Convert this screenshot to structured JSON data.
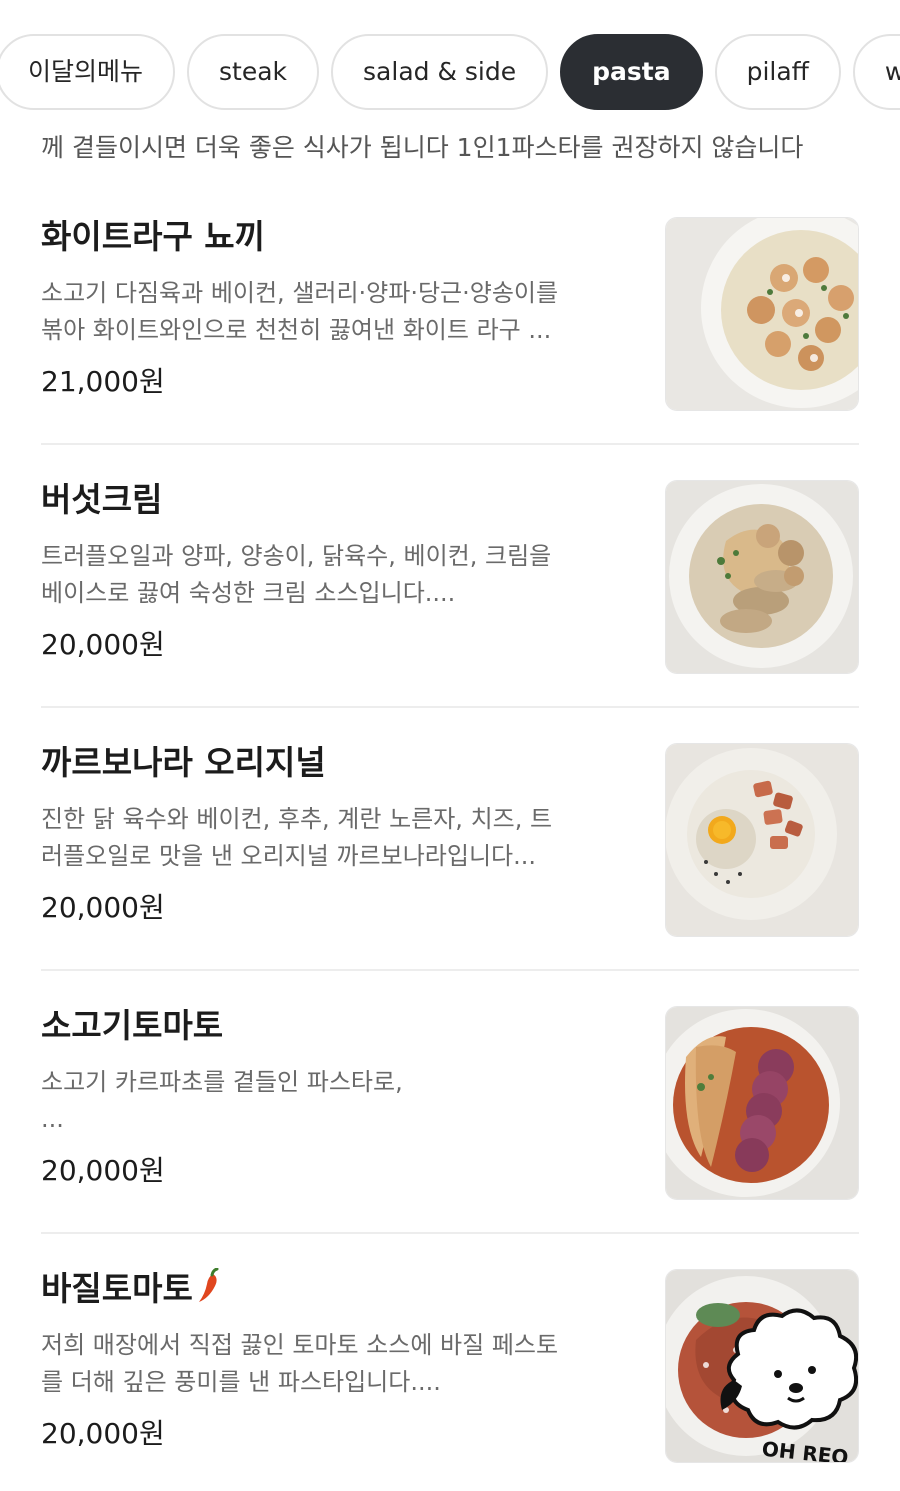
{
  "tabs": [
    {
      "label": "이달의메뉴",
      "active": false
    },
    {
      "label": "steak",
      "active": false
    },
    {
      "label": "salad & side",
      "active": false
    },
    {
      "label": "pasta",
      "active": true
    },
    {
      "label": "pilaff",
      "active": false
    },
    {
      "label": "wine",
      "active": false
    }
  ],
  "notice": "께 곁들이시면 더욱 좋은 식사가 됩니다 1인1파스타를 권장하지 않습니다",
  "menu": [
    {
      "name": "화이트라구 뇨끼",
      "desc": "소고기 다짐육과 베이컨, 샐러리·양파·당근·양송이를\n볶아 화이트와인으로 천천히 끓여낸 화이트 라구 ...",
      "price": "21,000원",
      "photo_icon": "gnocchi-plate"
    },
    {
      "name": "버섯크림",
      "desc": "트러플오일과 양파, 양송이, 닭육수, 베이컨, 크림을\n베이스로 끓여 숙성한 크림 소스입니다....",
      "price": "20,000원",
      "photo_icon": "mushroom-cream-plate"
    },
    {
      "name": "까르보나라 오리지널",
      "desc": "진한 닭 육수와 베이컨, 후추, 계란 노른자, 치즈, 트\n러플오일로 맛을 낸 오리지널 까르보나라입니다...",
      "price": "20,000원",
      "photo_icon": "carbonara-plate"
    },
    {
      "name": "소고기토마토",
      "desc": "소고기 카르파초를 곁들인 파스타로,\n ...",
      "price": "20,000원",
      "photo_icon": "beef-tomato-plate"
    },
    {
      "name": "바질토마토",
      "desc": "저희 매장에서 직접 끓인 토마토 소스에 바질 페스토\n를 더해 깊은 풍미를 낸 파스타입니다....",
      "price": "20,000원",
      "photo_icon": "basil-tomato-plate",
      "spicy_icon": "chili-pepper-icon",
      "watermark": "OH REO"
    }
  ],
  "colors": {
    "active_tab": "#2b2e33",
    "tab_border": "#e2e2e2",
    "text_primary": "#1c1c1c",
    "text_secondary": "#6a6a6a",
    "divider": "#ededed"
  }
}
